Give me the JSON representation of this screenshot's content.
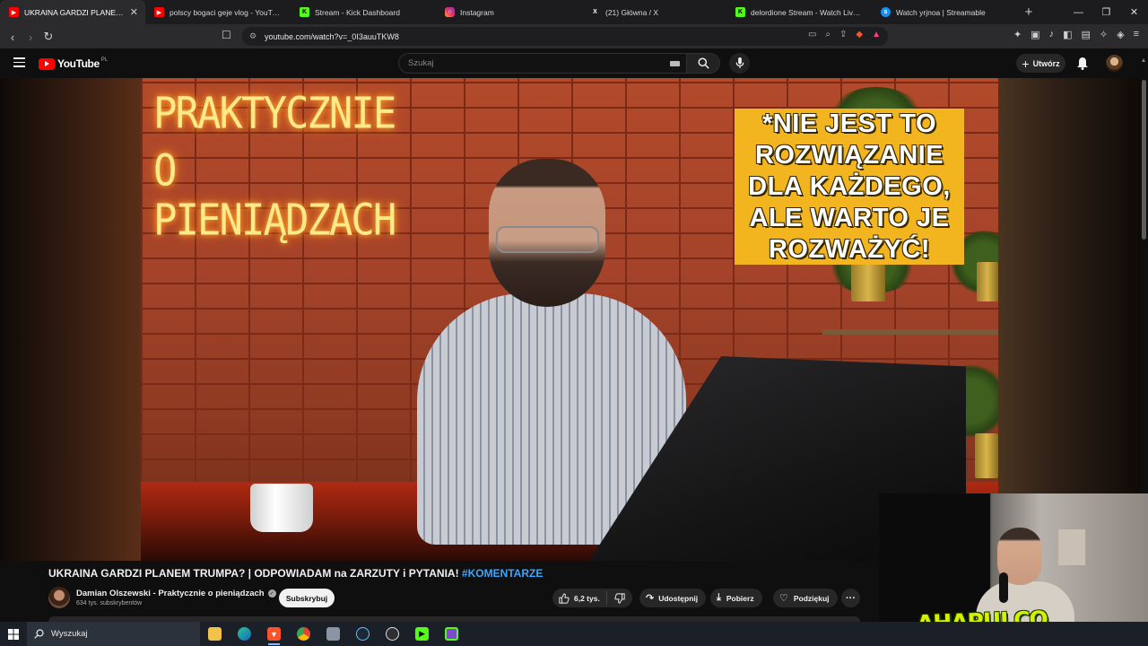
{
  "browser": {
    "tabs": [
      {
        "title": "UKRAINA GARDZI PLANEM TRUMPA? | ODPOWIADAM na ZARZUTY i PYTANIA! #KOMENTARZE - YouTube",
        "icon": "youtube-icon",
        "color": "#ff0000",
        "active": true
      },
      {
        "title": "polscy bogaci geje vlog - YouTube",
        "icon": "youtube-icon",
        "color": "#ff0000"
      },
      {
        "title": "Stream - Kick Dashboard",
        "icon": "kick-icon",
        "color": "#53fc18"
      },
      {
        "title": "Instagram",
        "icon": "instagram-icon",
        "color": "#e1306c"
      },
      {
        "title": "(21) Główna / X",
        "icon": "x-icon",
        "color": "#ffffff"
      },
      {
        "title": "delordione Stream - Watch Live on Kick",
        "icon": "kick-icon",
        "color": "#53fc18"
      },
      {
        "title": "Watch yrjnoa | Streamable",
        "icon": "streamable-icon",
        "color": "#0f90fa"
      }
    ],
    "url": "youtube.com/watch?v=_0I3auuTKW8"
  },
  "youtube": {
    "logo_text": "YouTube",
    "region": "PL",
    "search_placeholder": "Szukaj",
    "create_label": "Utwórz"
  },
  "video": {
    "thumbnail_sign": [
      "PRAKTYCZNIE O",
      "PIENIĄDZACH"
    ],
    "callout_text": "*NIE JEST TO ROZWIĄZANIE DLA KAŻDEGO, ALE WARTO JE ROZWAŻYĆ!",
    "title_main": "UKRAINA GARDZI PLANEM TRUMPA? | ODPOWIADAM na ZARZUTY i PYTANIA!",
    "title_hashtag": "#KOMENTARZE",
    "channel_name": "Damian Olszewski - Praktycznie o pieniądzach",
    "subscribers": "634 tys. subskrybentów",
    "subscribe_label": "Subskrybuj",
    "likes": "6,2 tys.",
    "share_label": "Udostępnij",
    "download_label": "Pobierz",
    "thanks_label": "Podziękuj",
    "more_label": "···"
  },
  "webcam": {
    "overlay_logo": "AHAPULCO"
  },
  "taskbar": {
    "search_placeholder": "Wyszukaj",
    "apps": [
      "file-explorer-icon",
      "edge-icon",
      "brave-icon",
      "chrome-icon",
      "app-icon",
      "steam-icon",
      "obs-icon",
      "kick-icon",
      "app-icon-2"
    ]
  }
}
